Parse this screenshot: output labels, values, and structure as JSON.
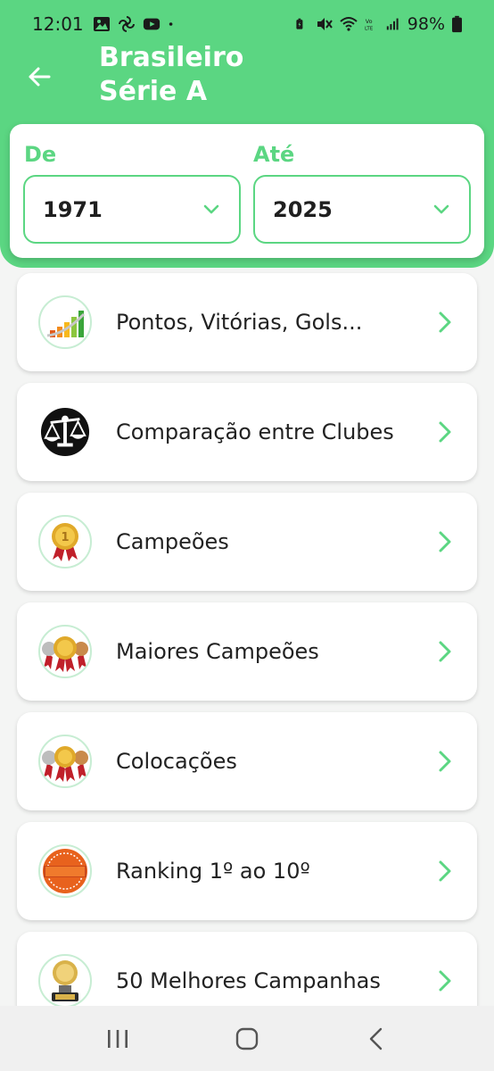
{
  "status_bar": {
    "time": "12:01",
    "battery_percent": "98%",
    "left_icons": [
      "gallery-icon",
      "pinwheel-icon",
      "youtube-icon",
      "dot-icon"
    ],
    "right_icons": [
      "battery-saver-icon",
      "mute-icon",
      "wifi-icon",
      "volte-icon",
      "signal-icon",
      "battery-icon"
    ]
  },
  "header": {
    "title": "Brasileiro Série A",
    "back_icon": "arrow-left-icon"
  },
  "filter": {
    "from_label": "De",
    "from_value": "1971",
    "to_label": "Até",
    "to_value": "2025"
  },
  "menu": {
    "items": [
      {
        "label": "Pontos, Vitórias, Gols...",
        "icon": "bar-chart-icon"
      },
      {
        "label": "Comparação entre Clubes",
        "icon": "scales-icon"
      },
      {
        "label": "Campeões",
        "icon": "gold-medal-icon"
      },
      {
        "label": "Maiores Campeões",
        "icon": "three-medals-icon"
      },
      {
        "label": "Colocações",
        "icon": "podium-medals-icon"
      },
      {
        "label": "Ranking 1º ao 10º",
        "icon": "ranking-badge-icon"
      },
      {
        "label": "50 Melhores Campanhas",
        "icon": "top-50-trophy-icon"
      }
    ]
  },
  "colors": {
    "primary": "#5bd682",
    "surface": "#ffffff",
    "background": "#f4f5f4",
    "text": "#222222"
  },
  "nav_bar": {
    "icons": [
      "recent-apps-icon",
      "home-icon",
      "back-icon"
    ]
  }
}
